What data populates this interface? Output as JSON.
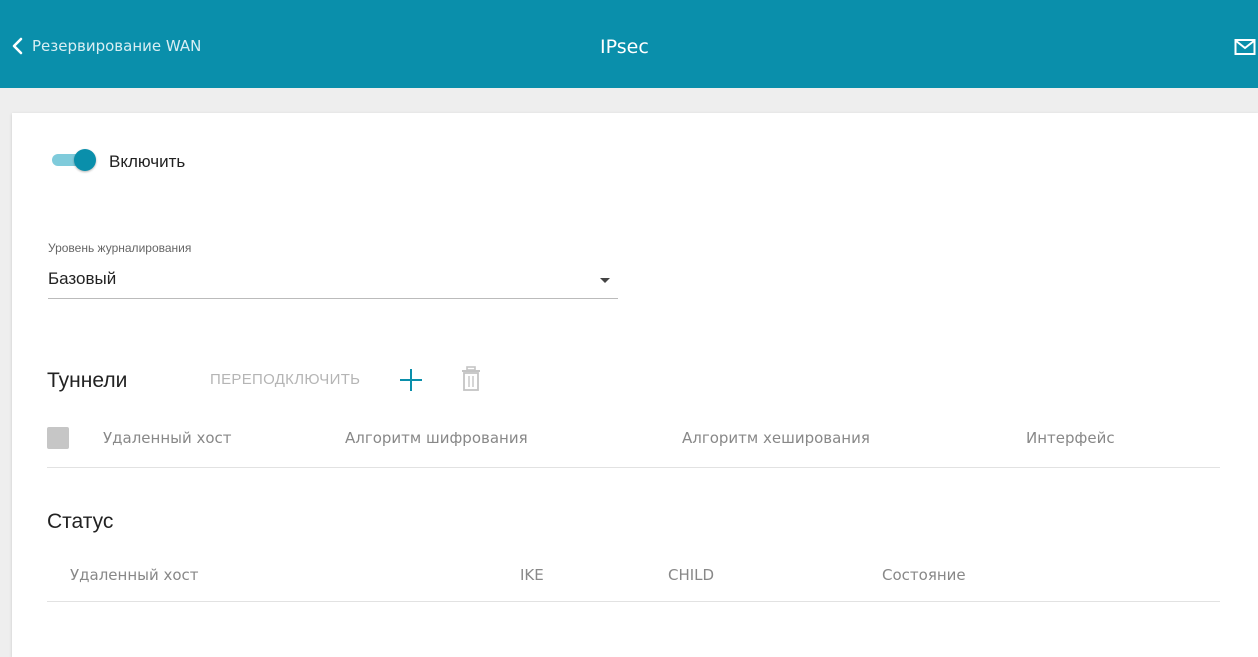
{
  "header": {
    "back_label": "Резервирование WAN",
    "title": "IPsec",
    "accent_color": "#0a8fab"
  },
  "enable": {
    "label": "Включить",
    "state": "on"
  },
  "log_level": {
    "caption": "Уровень журналирования",
    "value": "Базовый"
  },
  "tunnels": {
    "title": "Туннели",
    "reconnect_label": "ПЕРЕПОДКЛЮЧИТЬ",
    "columns": [
      "Удаленный хост",
      "Алгоритм шифрования",
      "Алгоритм хеширования",
      "Интерфейс"
    ],
    "rows": []
  },
  "status": {
    "title": "Статус",
    "columns": [
      "Удаленный хост",
      "IKE",
      "CHILD",
      "Состояние"
    ],
    "rows": []
  },
  "icons": {
    "back": "chevron-left-icon",
    "mail": "mail-icon",
    "add": "plus-icon",
    "delete": "trash-icon"
  }
}
